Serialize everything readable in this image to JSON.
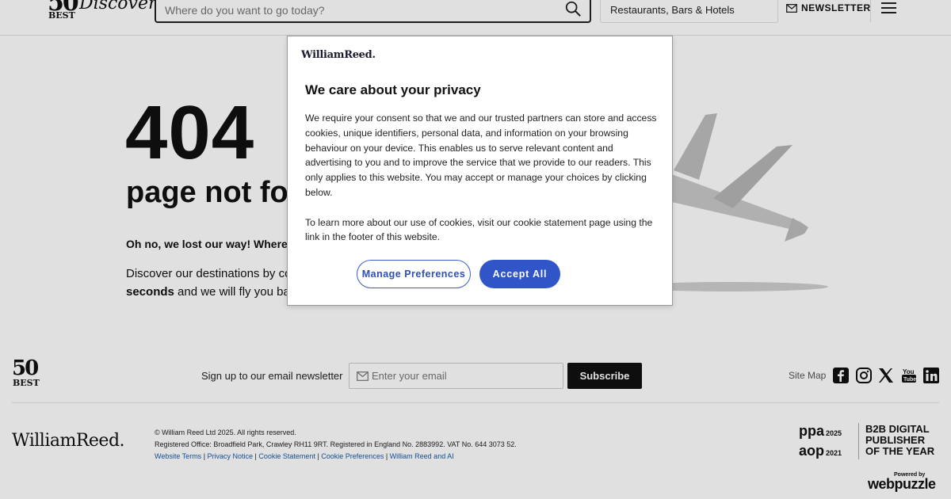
{
  "header": {
    "logo_number": "50",
    "logo_best": "BEST",
    "logo_script": "Discovery",
    "search_placeholder": "Where do you want to go today?",
    "category_selected": "Restaurants, Bars & Hotels",
    "newsletter_label": "NEWSLETTER"
  },
  "main": {
    "error_code": "404",
    "error_title": "page not found",
    "lost_text": "Oh no, we lost our way! Where to?",
    "discover_text_prefix": "Discover our destinations by cou",
    "discover_bold": "seconds",
    "discover_suffix": " and we will fly you back"
  },
  "consent": {
    "brand": "WilliamReed.",
    "title": "We care about your privacy",
    "body_p1": "We require your consent so that we and our trusted partners can store and access cookies, unique identifiers, personal data, and information on your browsing behaviour on your device. This enables us to serve relevant content and advertising to you and to improve the service that we provide to our readers. This only applies to this website. You may accept or manage your choices by clicking below.",
    "body_p2": "To learn more about our use of cookies, visit our cookie statement page using the link in the footer of this website.",
    "manage_label": "Manage Preferences",
    "accept_label": "Accept All"
  },
  "footer": {
    "logo_number": "50",
    "logo_best": "BEST",
    "signup_text": "Sign up to our email newsletter",
    "email_placeholder": "Enter your email",
    "subscribe_label": "Subscribe",
    "sitemap_label": "Site Map",
    "social_icons": [
      "facebook-icon",
      "instagram-icon",
      "x-icon",
      "youtube-icon",
      "linkedin-icon"
    ],
    "wr_logo": "WilliamReed.",
    "copyright": "© William Reed Ltd 2025. All rights reserved.",
    "registered": "Registered Office: Broadfield Park, Crawley RH11 9RT. Registered in England No. 2883992. VAT No. 644 3073 52.",
    "links": [
      "Website Terms",
      "Privacy Notice",
      "Cookie Statement",
      "Cookie Preferences",
      "William Reed and AI"
    ],
    "award_ppa": "ppa",
    "award_ppa_year": "2025",
    "award_aop": "aop",
    "award_aop_year": "2021",
    "award_line1": "B2B DIGITAL",
    "award_line2": "PUBLISHER",
    "award_line3": "OF THE YEAR",
    "powered_by": "Powered by",
    "webpuzzle": "webpuzzle"
  },
  "colors": {
    "accent_blue": "#2f55c9",
    "link_blue": "#1a5aa8",
    "dark": "#111111"
  }
}
